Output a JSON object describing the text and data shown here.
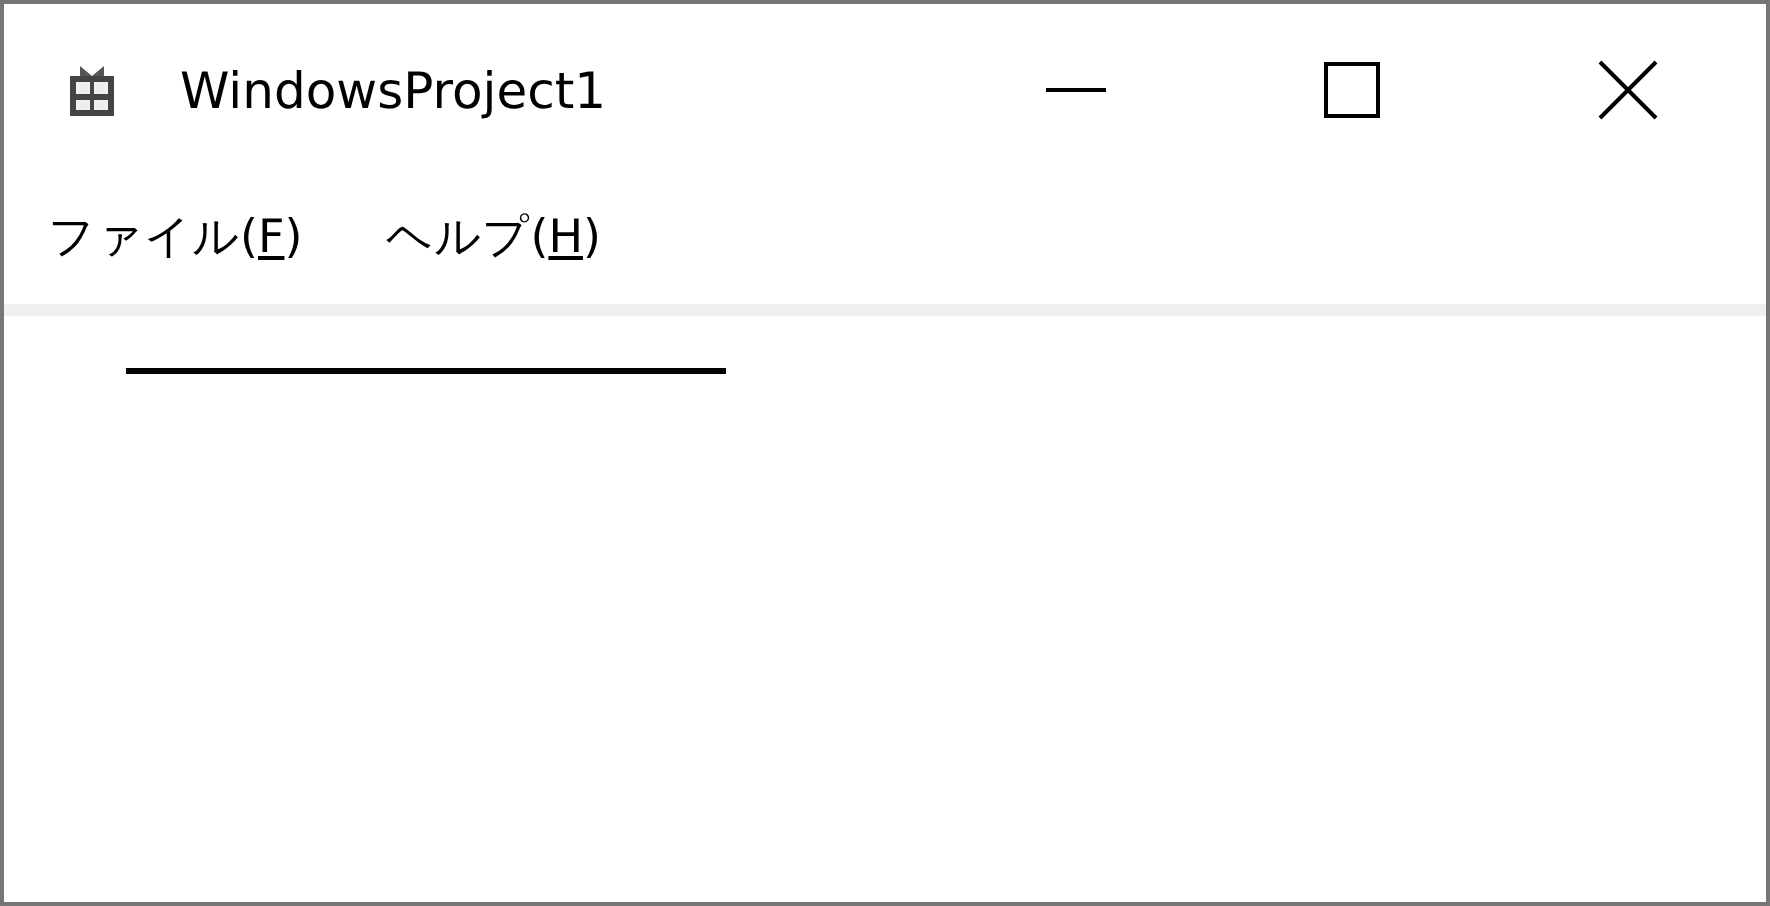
{
  "window": {
    "title": "WindowsProject1"
  },
  "menu": [
    {
      "before": "ファイル(",
      "access_key": "F",
      "after": ")"
    },
    {
      "before": "ヘルプ(",
      "access_key": "H",
      "after": ")"
    }
  ]
}
